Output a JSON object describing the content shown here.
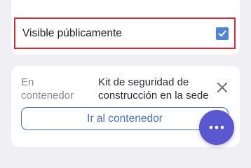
{
  "visibility": {
    "label": "Visible públicamente",
    "checked": true
  },
  "container": {
    "field_label": "En contenedor",
    "value": "Kit de seguridad de construcción en la sede",
    "go_button_label": "Ir al contenedor"
  },
  "colors": {
    "accent": "#4f84d6",
    "highlight_border": "#d42d3a",
    "fab": "#5b57d1",
    "button_outline": "#4a6fc4"
  },
  "icons": {
    "checkbox": "checkmark-icon",
    "close": "close-icon",
    "fab": "more-horizontal-icon"
  }
}
